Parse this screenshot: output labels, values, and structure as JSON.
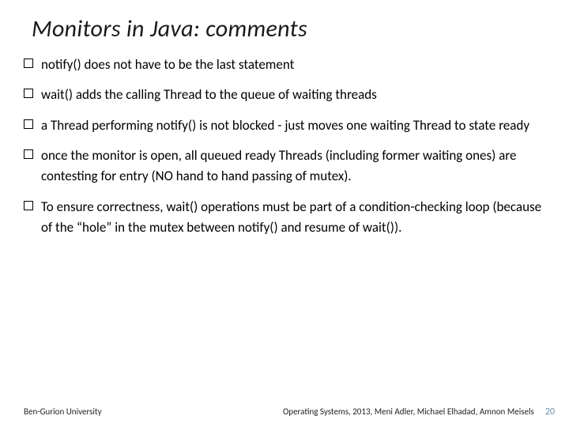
{
  "title": "Monitors  in Java: comments",
  "bullets": [
    "notify()  does not have to be the last statement",
    "wait()  adds the calling Thread to the queue of waiting threads",
    "a Thread performing notify() is not blocked - just moves one waiting Thread to state ready",
    "once the monitor is open, all queued ready Threads (including former waiting ones) are contesting for entry (NO hand to hand passing of mutex).",
    "To ensure correctness, wait() operations must be part of a condition-checking loop (because of the “hole” in the mutex between notify() and resume of wait())."
  ],
  "footer": {
    "university": "Ben-Gurion University",
    "course": "Operating Systems, 2013, Meni Adler, Michael Elhadad, Amnon Meisels",
    "page": "20"
  }
}
